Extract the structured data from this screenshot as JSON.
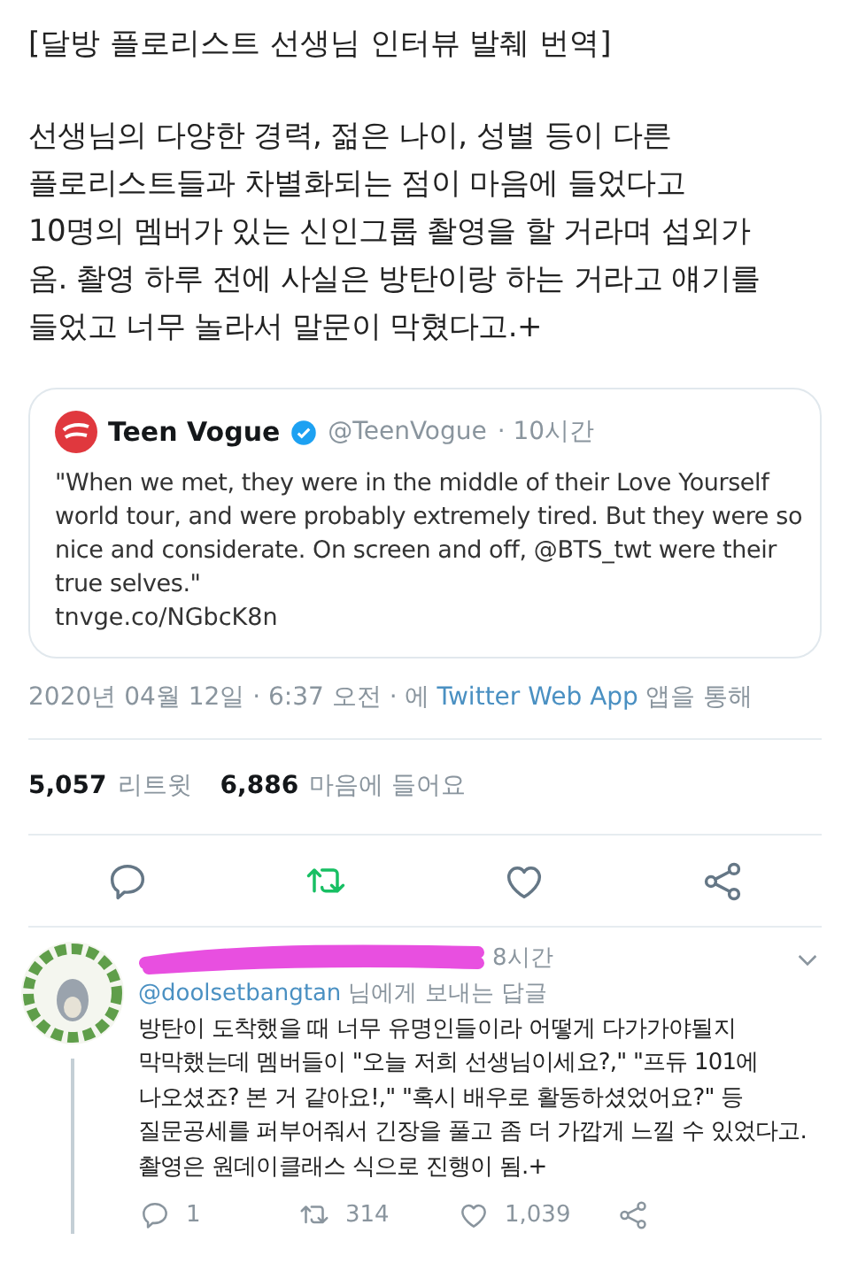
{
  "tweet": {
    "title": "[달방 플로리스트 선생님 인터뷰 발췌 번역]",
    "body_lines": [
      "선생님의 다양한 경력, 젊은 나이, 성별 등이 다른",
      "플로리스트들과 차별화되는 점이 마음에 들었다고",
      "10명의 멤버가 있는 신인그룹 촬영을 할 거라며 섭외가",
      "옴. 촬영 하루 전에 사실은 방탄이랑 하는 거라고 얘기를",
      "들었고 너무 놀라서 말문이 막혔다고.+"
    ],
    "quote": {
      "name": "Teen Vogue",
      "verified": true,
      "handle": "@TeenVogue",
      "time": "· 10시간",
      "text_lines": [
        "\"When we met, they were in the middle of their Love Yourself",
        "world tour, and were probably extremely tired. But they were so",
        "nice and considerate. On screen and off, @BTS_twt were their",
        "true selves.\""
      ],
      "link": "tnvge.co/NGbcK8n"
    },
    "date": "2020년 04월 12일 · 6:37 오전 · 에",
    "app": "Twitter Web App",
    "app_suffix": "앱을 통해",
    "stats": [
      {
        "count": "5,057",
        "label": "리트윗"
      },
      {
        "count": "6,886",
        "label": "마음에 들어요"
      }
    ],
    "retweeted": true,
    "liked": false
  },
  "reply": {
    "name_redacted": true,
    "time": "8시간",
    "to_handle": "@doolsetbangtan",
    "to_suffix": "님에게 보내는 답글",
    "text_lines": [
      "방탄이 도착했을 때 너무 유명인들이라 어떻게 다가가야될지",
      "막막했는데 멤버들이 \"오늘 저희 선생님이세요?,\" \"프듀 101에",
      "나오셨죠? 본 거 같아요!,\" \"혹시 배우로 활동하셨었어요?\" 등",
      "질문공세를 퍼부어줘서 긴장을 풀고 좀 더 가깝게 느낄 수 있었다고.",
      "촬영은 원데이클래스 식으로 진행이 됨.+"
    ],
    "actions": [
      {
        "kind": "reply",
        "count": "1"
      },
      {
        "kind": "retweet",
        "count": "314"
      },
      {
        "kind": "like",
        "count": "1,039"
      },
      {
        "kind": "share"
      }
    ]
  }
}
